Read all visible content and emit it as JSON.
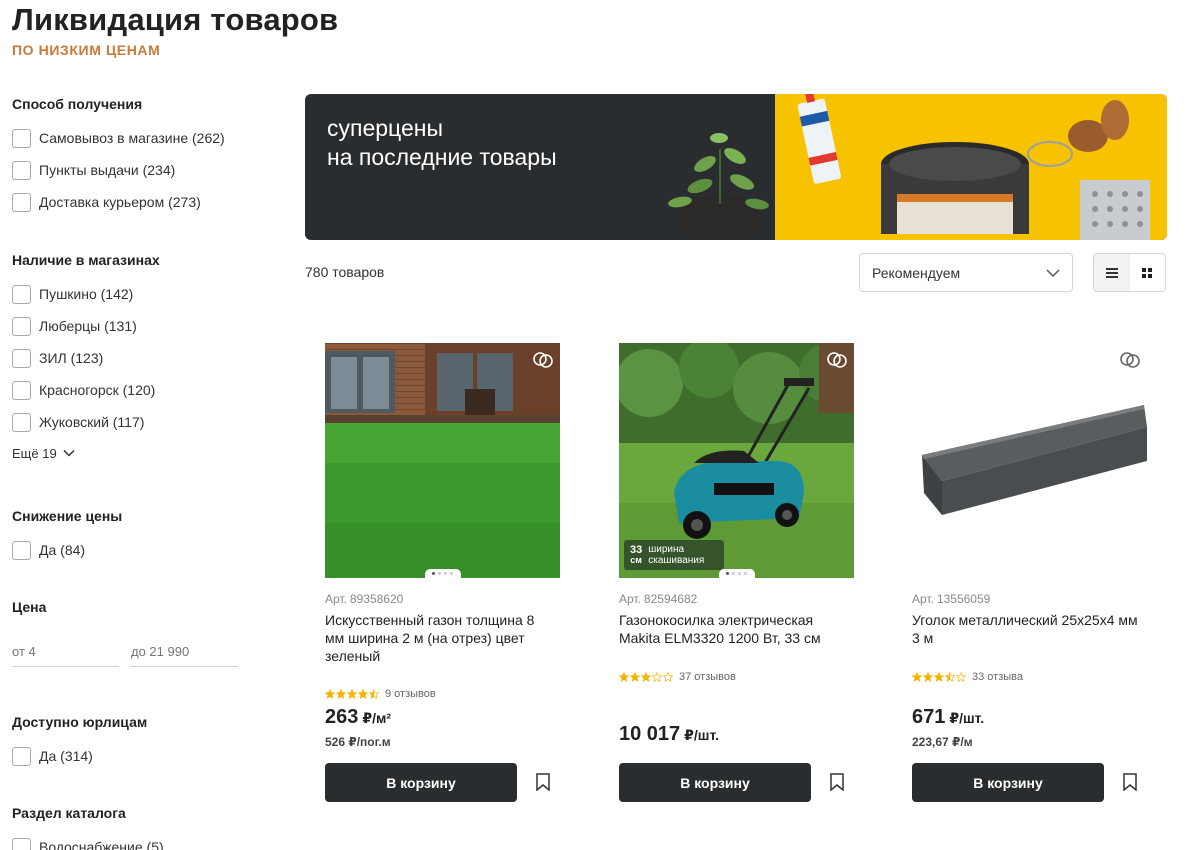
{
  "header": {
    "title": "Ликвидация товаров",
    "subtitle": "ПО НИЗКИМ ЦЕНАМ"
  },
  "filters": {
    "delivery": {
      "title": "Способ получения",
      "items": [
        "Самовывоз в магазине (262)",
        "Пункты выдачи (234)",
        "Доставка курьером (273)"
      ]
    },
    "stores": {
      "title": "Наличие в магазинах",
      "items": [
        "Пушкино (142)",
        "Люберцы (131)",
        "ЗИЛ (123)",
        "Красногорск (120)",
        "Жуковский (117)"
      ],
      "more": "Ещё 19"
    },
    "discount": {
      "title": "Снижение цены",
      "items": [
        "Да (84)"
      ]
    },
    "price": {
      "title": "Цена",
      "from_placeholder": "от 4",
      "to_placeholder": "до 21 990"
    },
    "legal": {
      "title": "Доступно юрлицам",
      "items": [
        "Да (314)"
      ]
    },
    "catalog": {
      "title": "Раздел каталога",
      "items": [
        "Водоснабжение (5)"
      ]
    }
  },
  "banner": {
    "line1": "суперцены",
    "line2": "на последние товары"
  },
  "toolbar": {
    "count": "780 товаров",
    "sort": "Рекомендуем"
  },
  "products": [
    {
      "sku_label": "Арт.",
      "sku": "89358620",
      "name": "Искусственный газон толщина 8 мм ширина 2 м (на отрез) цвет зеленый",
      "rating": 4.5,
      "reviews": "9 отзывов",
      "price": "263",
      "price_unit": "₽/м²",
      "price_sub": "526 ₽/пог.м",
      "cart": "В корзину"
    },
    {
      "sku_label": "Арт.",
      "sku": "82594682",
      "name": "Газонокосилка электрическая Makita ELM3320 1200 Вт, 33 см",
      "rating": 3,
      "reviews": "37 отзывов",
      "price": "10 017",
      "price_unit": "₽/шт.",
      "price_sub": "",
      "badge_num": "33",
      "badge_unit": "см",
      "badge_text1": "ширина",
      "badge_text2": "скашивания",
      "cart": "В корзину"
    },
    {
      "sku_label": "Арт.",
      "sku": "13556059",
      "name": "Уголок металлический 25х25х4 мм 3 м",
      "rating": 3.5,
      "reviews": "33 отзыва",
      "price": "671",
      "price_unit": "₽/шт.",
      "price_sub": "223,67 ₽/м",
      "cart": "В корзину"
    }
  ],
  "colors": {
    "accent_orange": "#c87a3a",
    "dark_button": "#2a2d30",
    "banner_yellow": "#f7c200",
    "star": "#f5b400"
  }
}
